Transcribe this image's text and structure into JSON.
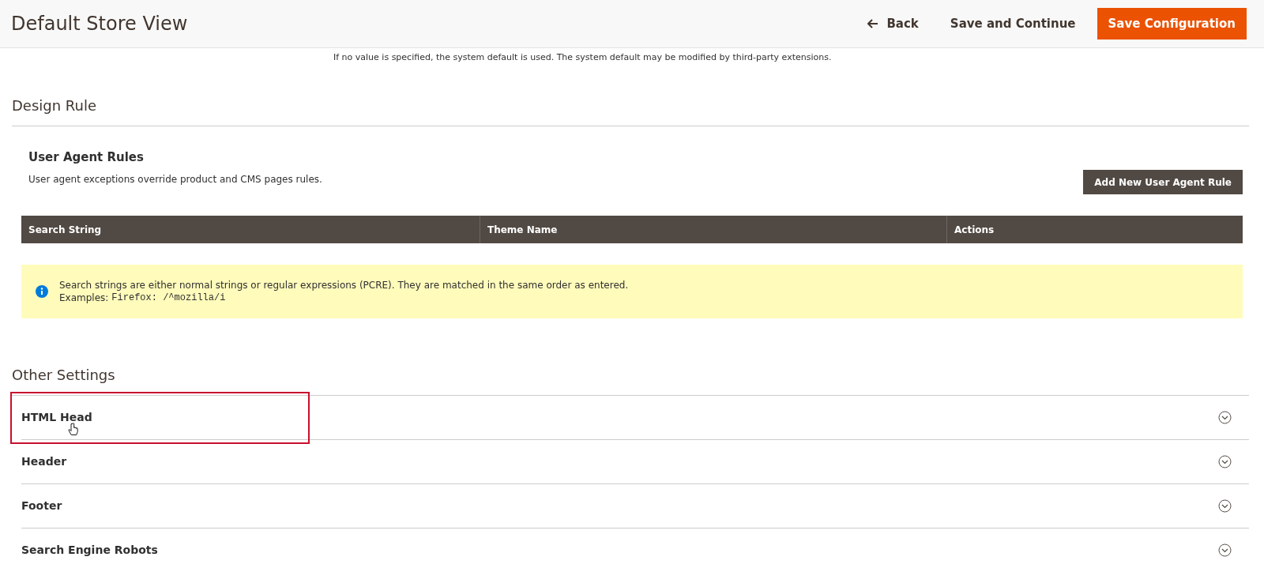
{
  "header": {
    "title": "Default Store View",
    "back": "Back",
    "save_continue": "Save and Continue",
    "save": "Save Configuration"
  },
  "note": "If no value is specified, the system default is used. The system default may be modified by third-party extensions.",
  "design_rule": {
    "title": "Design Rule",
    "subtitle": "User Agent Rules",
    "description": "User agent exceptions override product and CMS pages rules.",
    "add_button": "Add New User Agent Rule",
    "columns": [
      "Search String",
      "Theme Name",
      "Actions"
    ],
    "notice": {
      "text": "Search strings are either normal strings or regular expressions (PCRE). They are matched in the same order as entered.",
      "example_label": "Examples:",
      "example_code": "Firefox: /^mozilla/i"
    }
  },
  "other_settings": {
    "title": "Other Settings",
    "sections": [
      {
        "label": "HTML Head",
        "highlighted": true
      },
      {
        "label": "Header",
        "highlighted": false
      },
      {
        "label": "Footer",
        "highlighted": false
      },
      {
        "label": "Search Engine Robots",
        "highlighted": false
      }
    ]
  }
}
